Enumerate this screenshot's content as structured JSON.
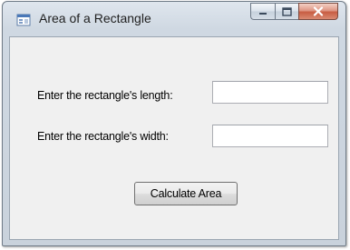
{
  "window": {
    "title": "Area of a Rectangle",
    "icon": "windows-form-icon",
    "caption_buttons": [
      "minimize-icon",
      "maximize-icon",
      "close-icon"
    ]
  },
  "form": {
    "length_label": "Enter the rectangle's length:",
    "length_value": "",
    "width_label": "Enter the rectangle's width:",
    "width_value": "",
    "calculate_button_label": "Calculate Area"
  }
}
